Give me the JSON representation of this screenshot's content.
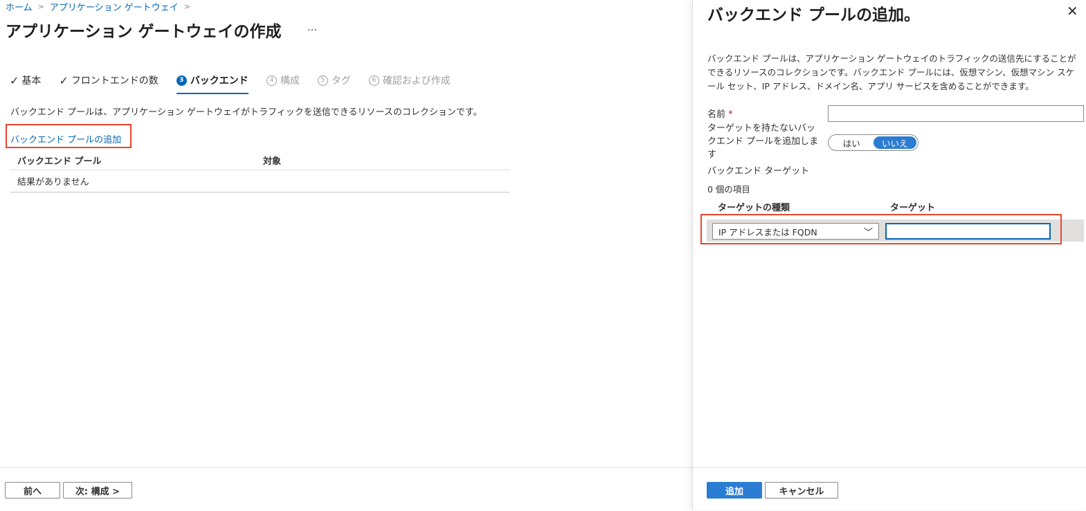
{
  "breadcrumb": {
    "items": [
      "ホーム",
      "アプリケーション ゲートウェイ"
    ]
  },
  "page": {
    "title": "アプリケーション ゲートウェイの作成",
    "more": "…"
  },
  "tabs": [
    {
      "label": "基本",
      "state": "done",
      "marker": "✓"
    },
    {
      "label": "フロントエンドの数",
      "state": "done",
      "marker": "✓"
    },
    {
      "label": "バックエンド",
      "state": "active",
      "marker": "3"
    },
    {
      "label": "構成",
      "state": "disabled",
      "marker": "4"
    },
    {
      "label": "タグ",
      "state": "disabled",
      "marker": "5"
    },
    {
      "label": "確認および作成",
      "state": "disabled",
      "marker": "6"
    }
  ],
  "backend": {
    "description": "バックエンド プールは、アプリケーション ゲートウェイがトラフィックを送信できるリソースのコレクションです。",
    "add_link": "バックエンド プールの追加",
    "columns": [
      "バックエンド プール",
      "対象"
    ],
    "empty_text": "結果がありません"
  },
  "footer": {
    "prev": "前へ",
    "next": "次: 構成 >"
  },
  "panel": {
    "title": "バックエンド プールの追加。",
    "close": "✕",
    "description": "バックエンド プールは、アプリケーション ゲートウェイのトラフィックの送信先にすることができるリソースのコレクションです。バックエンド プールには、仮想マシン、仮想マシン スケール セット、IP アドレス、ドメイン名、アプリ サービスを含めることができます。",
    "name_label": "名前",
    "name_required": "*",
    "name_value": "",
    "no_target_label": "ターゲットを持たないバックエンド プールを追加します",
    "toggle_yes": "はい",
    "toggle_no": "いいえ",
    "toggle_selected": "いいえ",
    "backend_targets_label": "バックエンド ターゲット",
    "item_count": "0 個の項目",
    "col_target_type": "ターゲットの種類",
    "col_target": "ターゲット",
    "target_type_value": "IP アドレスまたは FQDN",
    "target_value": "",
    "add_button": "追加",
    "cancel_button": "キャンセル"
  },
  "colors": {
    "accent": "#0067b8",
    "primary_button": "#2b7cd3",
    "highlight_box": "#e8462b"
  }
}
